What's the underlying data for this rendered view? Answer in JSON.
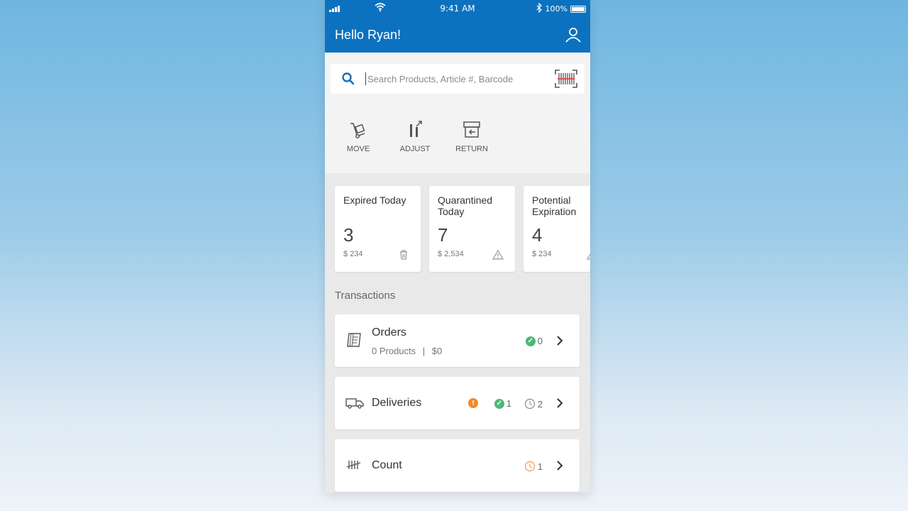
{
  "status_bar": {
    "time": "9:41 AM",
    "battery": "100%"
  },
  "header": {
    "greeting": "Hello Ryan!",
    "profile_icon": "user-icon"
  },
  "search": {
    "placeholder": "Search Products, Article #, Barcode",
    "icon": "search-icon",
    "scan_icon": "barcode-scan-icon"
  },
  "actions": [
    {
      "label": "MOVE",
      "icon": "hand-truck-icon"
    },
    {
      "label": "ADJUST",
      "icon": "adjust-icon"
    },
    {
      "label": "RETURN",
      "icon": "return-icon"
    }
  ],
  "summary_cards": [
    {
      "title": "Expired Today",
      "count": "3",
      "amount": "$ 234",
      "icon": "trash-icon"
    },
    {
      "title": "Quarantined Today",
      "count": "7",
      "amount": "$ 2,534",
      "icon": "warning-icon"
    },
    {
      "title": "Potential Expiration",
      "count": "4",
      "amount": "$ 234",
      "icon": "warning-icon"
    }
  ],
  "transactions": {
    "label": "Transactions",
    "orders": {
      "title": "Orders",
      "products": "0 Products",
      "separator": "|",
      "value": "$0",
      "done_count": "0"
    },
    "deliveries": {
      "title": "Deliveries",
      "alert": "!",
      "done_count": "1",
      "pending_count": "2"
    },
    "count": {
      "title": "Count",
      "pending_count": "1"
    }
  },
  "colors": {
    "brand": "#0c72bf",
    "success": "#4cb875",
    "alert": "#ef8a2b",
    "pending": "#9a9a9a",
    "count_pending": "#f0a46a"
  }
}
